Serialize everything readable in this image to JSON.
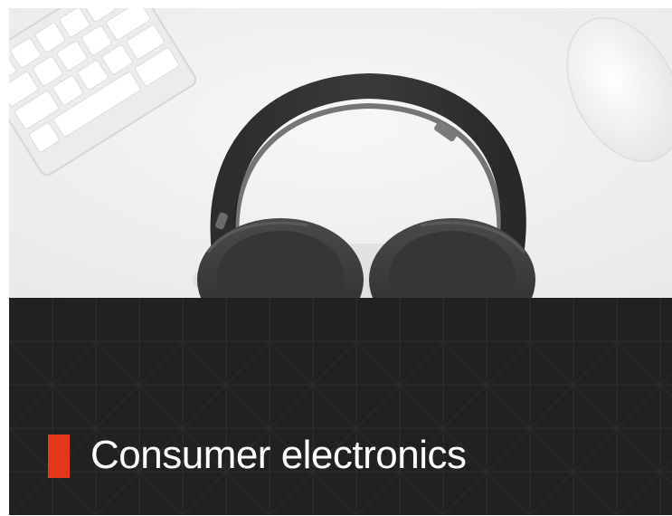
{
  "category": {
    "title": "Consumer electronics",
    "accent_color": "#e5381f",
    "banner_color": "#212121"
  },
  "hero_image": {
    "subject": "headphones-on-desk"
  }
}
